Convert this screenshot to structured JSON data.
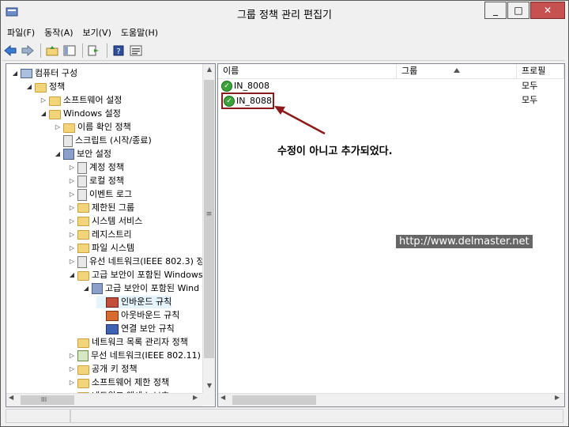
{
  "window": {
    "title": "그룹 정책 관리 편집기",
    "close_glyph": "✕",
    "min_glyph": "_",
    "max_glyph": "□"
  },
  "menu": [
    "파일(F)",
    "동작(A)",
    "보기(V)",
    "도움말(H)"
  ],
  "toolbar": {
    "icons": [
      "back-icon",
      "forward-icon",
      "up-folder-icon",
      "show-hide-tree-icon",
      "export-list-icon",
      "help-icon",
      "properties-icon"
    ]
  },
  "tree": {
    "expanded_glyph": "◢",
    "collapsed_glyph": "▷",
    "nodes": [
      {
        "label": "컴퓨터 구성",
        "icon": "computer"
      },
      {
        "label": "정책",
        "icon": "folder"
      },
      {
        "label": "소프트웨어 설정",
        "icon": "folder"
      },
      {
        "label": "Windows 설정",
        "icon": "folder"
      },
      {
        "label": "이름 확인 정책",
        "icon": "folder"
      },
      {
        "label": "스크립트 (시작/종료)",
        "icon": "document"
      },
      {
        "label": "보안 설정",
        "icon": "shield"
      },
      {
        "label": "계정 정책",
        "icon": "document"
      },
      {
        "label": "로컬 정책",
        "icon": "document"
      },
      {
        "label": "이벤트 로그",
        "icon": "document"
      },
      {
        "label": "제한된 그룹",
        "icon": "lock-folder"
      },
      {
        "label": "시스템 서비스",
        "icon": "lock-folder"
      },
      {
        "label": "레지스트리",
        "icon": "lock-folder"
      },
      {
        "label": "파일 시스템",
        "icon": "lock-folder"
      },
      {
        "label": "유선 네트워크(IEEE 802.3) 정",
        "icon": "document"
      },
      {
        "label": "고급 보안이 포함된 Windows",
        "icon": "folder"
      },
      {
        "label": "고급 보안이 포함된 Wind",
        "icon": "shield"
      },
      {
        "label": "인바운드 규칙",
        "icon": "inbound-rule"
      },
      {
        "label": "아웃바운드 규칙",
        "icon": "outbound-rule"
      },
      {
        "label": "연결 보안 규칙",
        "icon": "security-rule"
      },
      {
        "label": "네트워크 목록 관리자 정책",
        "icon": "folder"
      },
      {
        "label": "무선 네트워크(IEEE 802.11) 정",
        "icon": "network"
      },
      {
        "label": "공개 키 정책",
        "icon": "folder"
      },
      {
        "label": "소프트웨어 제한 정책",
        "icon": "folder"
      },
      {
        "label": "네트워크 액세스 보호",
        "icon": "folder"
      }
    ]
  },
  "list": {
    "columns": [
      "이름",
      "그룹",
      "프로필"
    ],
    "rows": [
      {
        "name": "IN_8008",
        "profile": "모두"
      },
      {
        "name": "IN_8088",
        "profile": "모두"
      }
    ]
  },
  "annotation": {
    "text": "수정이 아니고 추가되었다.",
    "color": "#8b1a1a"
  },
  "watermark": "http://www.delmaster.net",
  "scroll_glyphs": {
    "up": "▲",
    "down": "▼",
    "left": "◀",
    "right": "▶",
    "grip": "≡",
    "hgrip": "III"
  }
}
